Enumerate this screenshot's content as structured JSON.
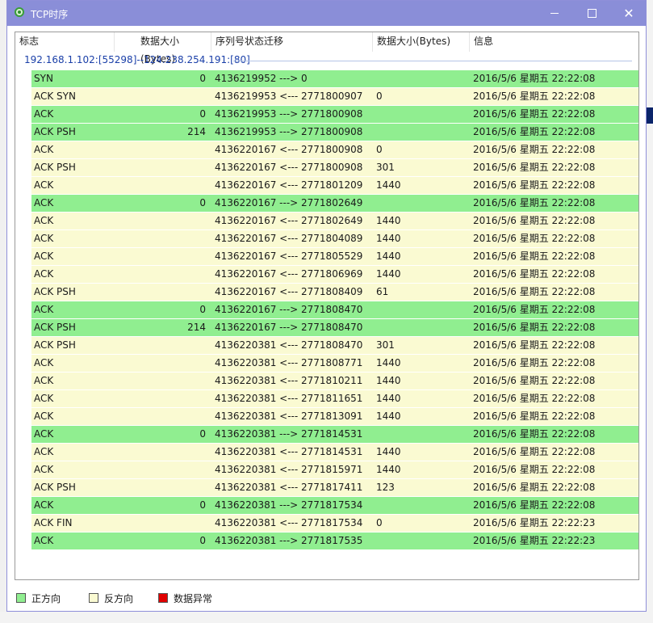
{
  "window": {
    "title": "TCP时序",
    "controls": {
      "minimize": "minimize-icon",
      "maximize": "maximize-icon",
      "close": "close-icon"
    }
  },
  "columns": [
    "标志",
    "数据大小(Bytes)",
    "序列号状态迁移",
    "数据大小(Bytes)",
    "信息"
  ],
  "group": {
    "label": "192.168.1.102:[55298]--124.238.254.191:[80]"
  },
  "rows": [
    {
      "dir": "fwd",
      "flag": "SYN",
      "size1": "0",
      "seq": "4136219952 ---> 0",
      "size2": "",
      "info": "2016/5/6 星期五 22:22:08"
    },
    {
      "dir": "rev",
      "flag": "ACK SYN",
      "size1": "",
      "seq": "4136219953 <--- 2771800907",
      "size2": "0",
      "info": "2016/5/6 星期五 22:22:08"
    },
    {
      "dir": "fwd",
      "flag": "ACK",
      "size1": "0",
      "seq": "4136219953 ---> 2771800908",
      "size2": "",
      "info": "2016/5/6 星期五 22:22:08"
    },
    {
      "dir": "fwd",
      "flag": "ACK PSH",
      "size1": "214",
      "seq": "4136219953 ---> 2771800908",
      "size2": "",
      "info": "2016/5/6 星期五 22:22:08"
    },
    {
      "dir": "rev",
      "flag": "ACK",
      "size1": "",
      "seq": "4136220167 <--- 2771800908",
      "size2": "0",
      "info": "2016/5/6 星期五 22:22:08"
    },
    {
      "dir": "rev",
      "flag": "ACK PSH",
      "size1": "",
      "seq": "4136220167 <--- 2771800908",
      "size2": "301",
      "info": "2016/5/6 星期五 22:22:08"
    },
    {
      "dir": "rev",
      "flag": "ACK",
      "size1": "",
      "seq": "4136220167 <--- 2771801209",
      "size2": "1440",
      "info": "2016/5/6 星期五 22:22:08"
    },
    {
      "dir": "fwd",
      "flag": "ACK",
      "size1": "0",
      "seq": "4136220167 ---> 2771802649",
      "size2": "",
      "info": "2016/5/6 星期五 22:22:08"
    },
    {
      "dir": "rev",
      "flag": "ACK",
      "size1": "",
      "seq": "4136220167 <--- 2771802649",
      "size2": "1440",
      "info": "2016/5/6 星期五 22:22:08"
    },
    {
      "dir": "rev",
      "flag": "ACK",
      "size1": "",
      "seq": "4136220167 <--- 2771804089",
      "size2": "1440",
      "info": "2016/5/6 星期五 22:22:08"
    },
    {
      "dir": "rev",
      "flag": "ACK",
      "size1": "",
      "seq": "4136220167 <--- 2771805529",
      "size2": "1440",
      "info": "2016/5/6 星期五 22:22:08"
    },
    {
      "dir": "rev",
      "flag": "ACK",
      "size1": "",
      "seq": "4136220167 <--- 2771806969",
      "size2": "1440",
      "info": "2016/5/6 星期五 22:22:08"
    },
    {
      "dir": "rev",
      "flag": "ACK PSH",
      "size1": "",
      "seq": "4136220167 <--- 2771808409",
      "size2": "61",
      "info": "2016/5/6 星期五 22:22:08"
    },
    {
      "dir": "fwd",
      "flag": "ACK",
      "size1": "0",
      "seq": "4136220167 ---> 2771808470",
      "size2": "",
      "info": "2016/5/6 星期五 22:22:08"
    },
    {
      "dir": "fwd",
      "flag": "ACK PSH",
      "size1": "214",
      "seq": "4136220167 ---> 2771808470",
      "size2": "",
      "info": "2016/5/6 星期五 22:22:08"
    },
    {
      "dir": "rev",
      "flag": "ACK PSH",
      "size1": "",
      "seq": "4136220381 <--- 2771808470",
      "size2": "301",
      "info": "2016/5/6 星期五 22:22:08"
    },
    {
      "dir": "rev",
      "flag": "ACK",
      "size1": "",
      "seq": "4136220381 <--- 2771808771",
      "size2": "1440",
      "info": "2016/5/6 星期五 22:22:08"
    },
    {
      "dir": "rev",
      "flag": "ACK",
      "size1": "",
      "seq": "4136220381 <--- 2771810211",
      "size2": "1440",
      "info": "2016/5/6 星期五 22:22:08"
    },
    {
      "dir": "rev",
      "flag": "ACK",
      "size1": "",
      "seq": "4136220381 <--- 2771811651",
      "size2": "1440",
      "info": "2016/5/6 星期五 22:22:08"
    },
    {
      "dir": "rev",
      "flag": "ACK",
      "size1": "",
      "seq": "4136220381 <--- 2771813091",
      "size2": "1440",
      "info": "2016/5/6 星期五 22:22:08"
    },
    {
      "dir": "fwd",
      "flag": "ACK",
      "size1": "0",
      "seq": "4136220381 ---> 2771814531",
      "size2": "",
      "info": "2016/5/6 星期五 22:22:08"
    },
    {
      "dir": "rev",
      "flag": "ACK",
      "size1": "",
      "seq": "4136220381 <--- 2771814531",
      "size2": "1440",
      "info": "2016/5/6 星期五 22:22:08"
    },
    {
      "dir": "rev",
      "flag": "ACK",
      "size1": "",
      "seq": "4136220381 <--- 2771815971",
      "size2": "1440",
      "info": "2016/5/6 星期五 22:22:08"
    },
    {
      "dir": "rev",
      "flag": "ACK PSH",
      "size1": "",
      "seq": "4136220381 <--- 2771817411",
      "size2": "123",
      "info": "2016/5/6 星期五 22:22:08"
    },
    {
      "dir": "fwd",
      "flag": "ACK",
      "size1": "0",
      "seq": "4136220381 ---> 2771817534",
      "size2": "",
      "info": "2016/5/6 星期五 22:22:08"
    },
    {
      "dir": "rev",
      "flag": "ACK FIN",
      "size1": "",
      "seq": "4136220381 <--- 2771817534",
      "size2": "0",
      "info": "2016/5/6 星期五 22:22:23"
    },
    {
      "dir": "fwd",
      "flag": "ACK",
      "size1": "0",
      "seq": "4136220381 ---> 2771817535",
      "size2": "",
      "info": "2016/5/6 星期五 22:22:23"
    }
  ],
  "legend": [
    {
      "label": "正方向",
      "color": "#90ee90"
    },
    {
      "label": "反方向",
      "color": "#fafad2"
    },
    {
      "label": "数据异常",
      "color": "#e00000"
    }
  ],
  "colors": {
    "forward": "#90ee90",
    "reverse": "#fafad2",
    "titlebar": "#8a8ed8",
    "group_text": "#1a3fa8"
  }
}
